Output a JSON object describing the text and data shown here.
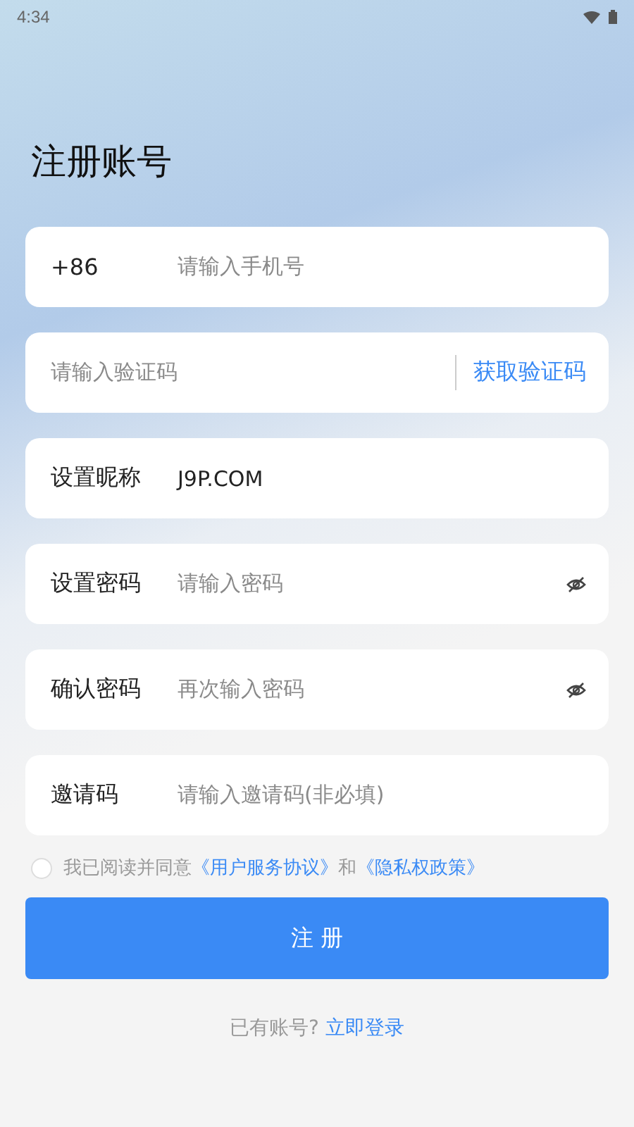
{
  "status_bar": {
    "time": "4:34"
  },
  "title": "注册账号",
  "fields": [
    {
      "kind": "phone",
      "label": "+86",
      "placeholder": "请输入手机号"
    },
    {
      "kind": "code",
      "placeholder": "请输入验证码",
      "action": "获取验证码"
    },
    {
      "kind": "text",
      "label": "设置昵称",
      "value": "J9P.COM"
    },
    {
      "kind": "password",
      "label": "设置密码",
      "placeholder": "请输入密码"
    },
    {
      "kind": "password",
      "label": "确认密码",
      "placeholder": "再次输入密码"
    },
    {
      "kind": "text",
      "label": "邀请码",
      "placeholder": "请输入邀请码(非必填)"
    }
  ],
  "agreement": {
    "checked": false,
    "text": "我已阅读并同意",
    "link1": "《用户服务协议》",
    "joiner": "和",
    "link2": "《隐私权政策》"
  },
  "submit": "注 册",
  "footer": {
    "text": "已有账号?",
    "link": "立即登录"
  }
}
